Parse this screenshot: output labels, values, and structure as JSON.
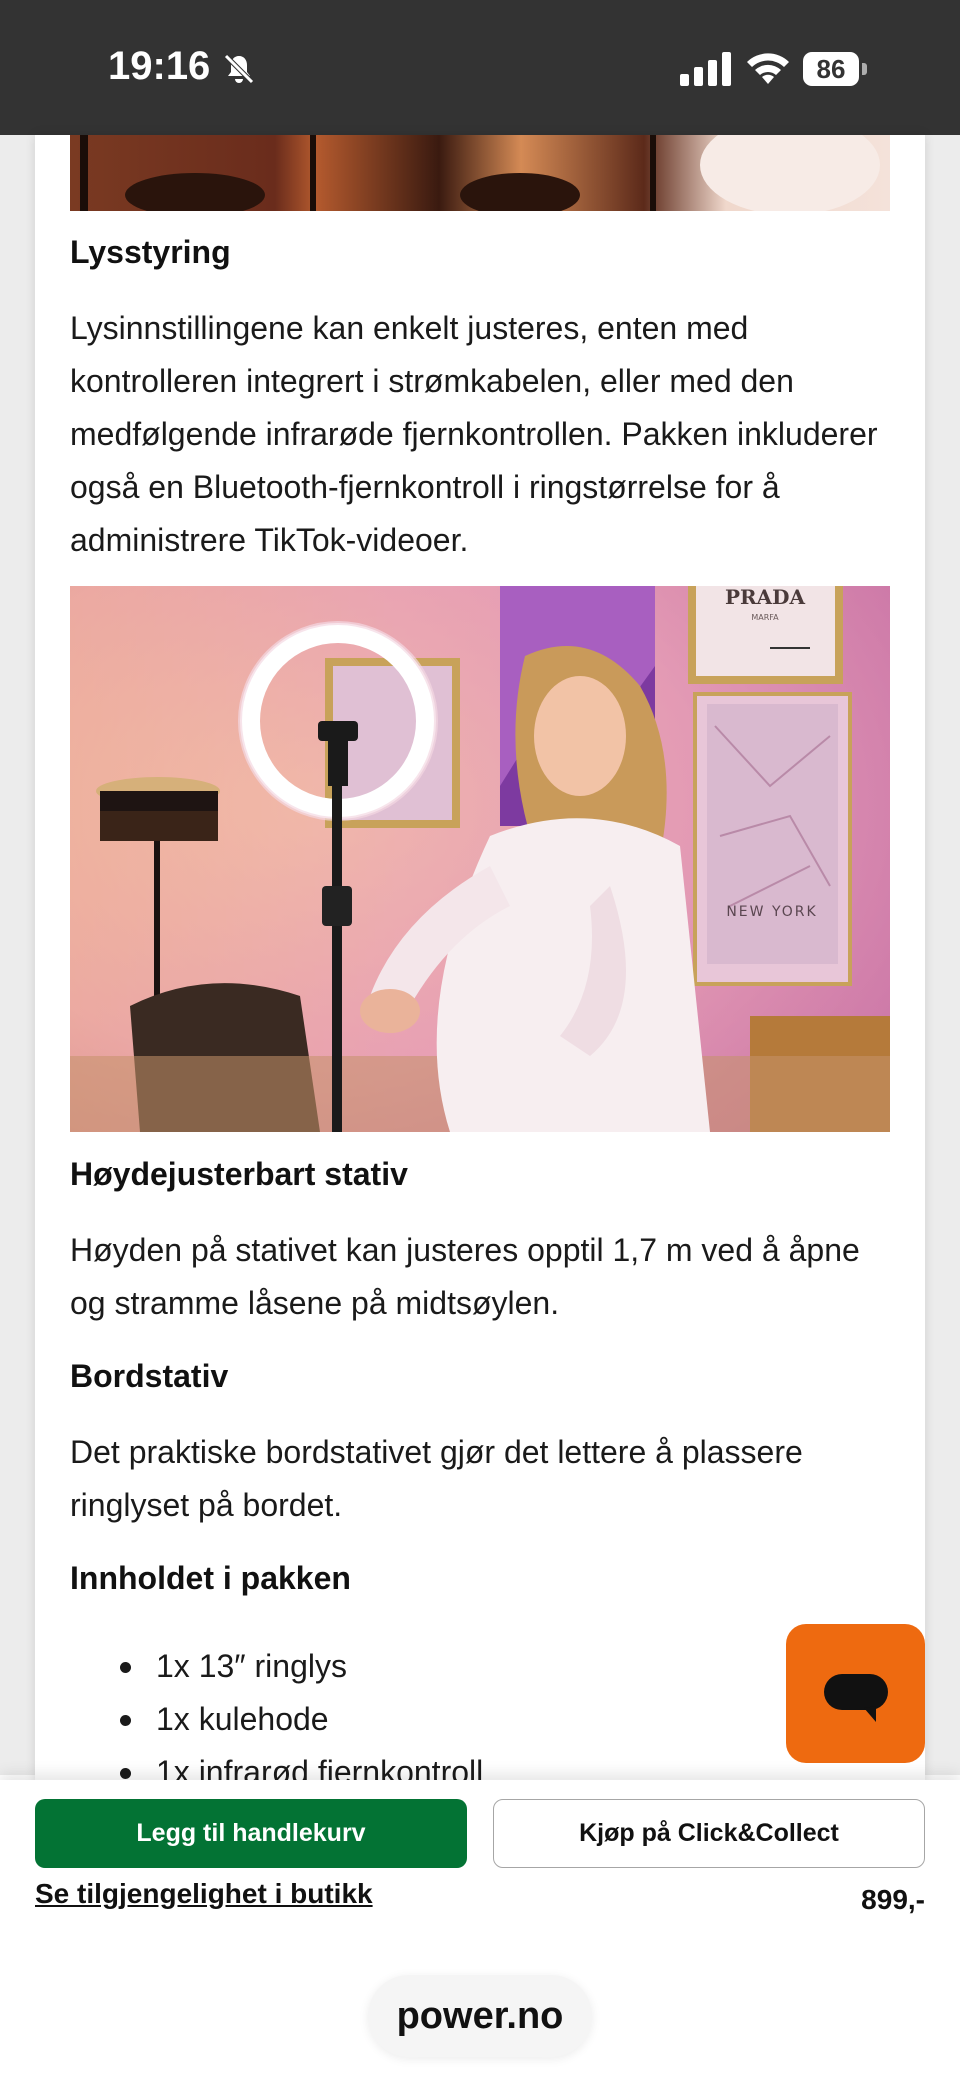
{
  "status_bar": {
    "time": "19:16",
    "battery_level": "86",
    "icons": [
      "bell-muted-icon",
      "cellular-signal-icon",
      "wifi-icon",
      "battery-icon"
    ]
  },
  "article": {
    "sections": [
      {
        "heading": "Lysstyring",
        "text": "Lysinnstillingene kan enkelt justeres, enten med kontrolleren integrert i strømkabelen, eller med den medfølgende infrarøde fjernkontrollen. Pakken inkluderer også en Bluetooth-fjernkontroll i ringstørrelse for å administrere TikTok-videoer."
      },
      {
        "heading": "Høydejusterbart stativ",
        "text": "Høyden på stativet kan justeres opptil 1,7 m ved å åpne og stramme låsene på midtsøylen."
      },
      {
        "heading": "Bordstativ",
        "text": "Det praktiske bordstativet gjør det lettere å plassere ringlyset på bordet."
      },
      {
        "heading": "Innholdet i pakken",
        "items": [
          "1x 13″ ringlys",
          "1x kulehode",
          "1x infrarød fjernkontroll"
        ]
      }
    ],
    "photo": {
      "poster_brand": "PRADA",
      "poster_sub": "MARFA",
      "map_label": "NEW YORK"
    }
  },
  "chat": {
    "icon": "chat-bubble-icon"
  },
  "purchase_bar": {
    "add_to_cart_label": "Legg til handlekurv",
    "click_collect_label": "Kjøp på Click&Collect",
    "store_availability_link": "Se tilgjengelighet i butikk",
    "price": "899,-"
  },
  "browser": {
    "url": "power.no"
  },
  "colors": {
    "status_bar_bg": "#333333",
    "brand_green": "#037334",
    "chat_orange": "#EE6A10"
  }
}
